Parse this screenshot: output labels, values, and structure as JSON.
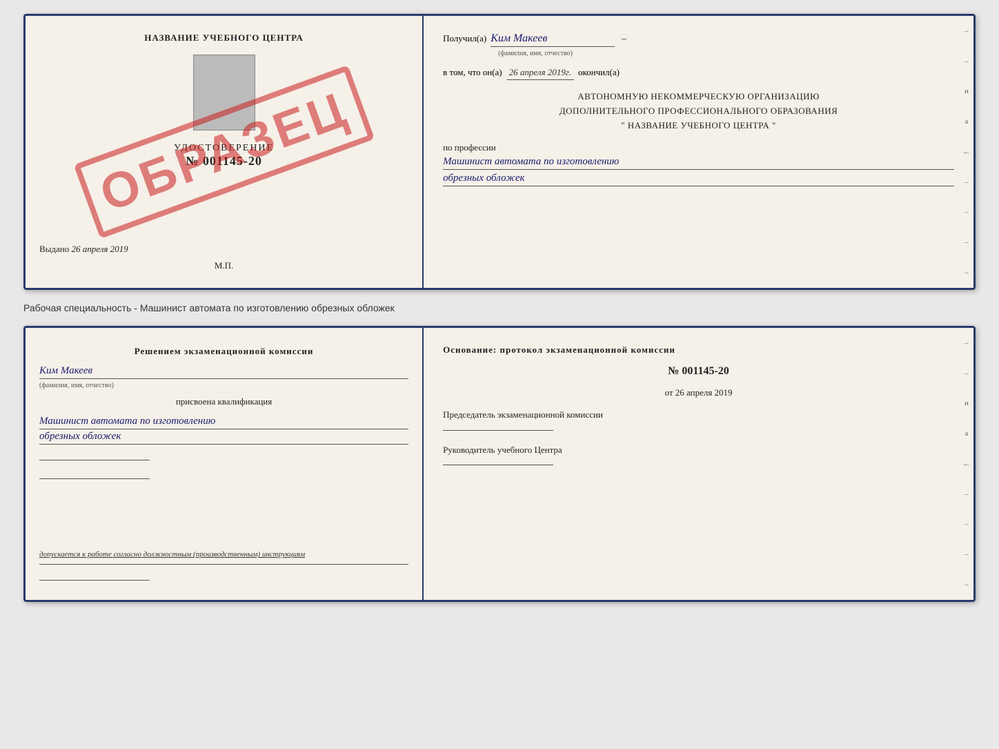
{
  "top_card": {
    "left": {
      "center_title": "НАЗВАНИЕ УЧЕБНОГО ЦЕНТРА",
      "udostoverenie_label": "УДОСТОВЕРЕНИЕ",
      "number": "№ 001145-20",
      "vydano_label": "Выдано",
      "vydano_date": "26 апреля 2019",
      "mp_label": "М.П.",
      "stamp": "ОБРАЗЕЦ"
    },
    "right": {
      "poluchil_prefix": "Получил(а)",
      "poluchil_name": "Ким Макеев",
      "sub_fio": "(фамилия, имя, отчество)",
      "dash": "–",
      "vtom_label": "в том, что он(а)",
      "vtom_date": "26 апреля 2019г.",
      "okoncil_label": "окончил(а)",
      "org_line1": "АВТОНОМНУЮ НЕКОММЕРЧЕСКУЮ ОРГАНИЗАЦИЮ",
      "org_line2": "ДОПОЛНИТЕЛЬНОГО ПРОФЕССИОНАЛЬНОГО ОБРАЗОВАНИЯ",
      "org_line3": "\"  НАЗВАНИЕ УЧЕБНОГО ЦЕНТРА  \"",
      "profesia_label": "по профессии",
      "profesia_line1": "Машинист автомата по изготовлению",
      "profesia_line2": "обрезных обложек"
    }
  },
  "caption": {
    "text": "Рабочая специальность - Машинист автомата по изготовлению обрезных обложек"
  },
  "bottom_card": {
    "left": {
      "resheniem_label": "Решением экзаменационной комиссии",
      "komissia_name": "Ким Макеев",
      "sub_fio": "(фамилия, имя, отчество)",
      "prisvoena_label": "присвоена квалификация",
      "kvali_line1": "Машинист автомата по изготовлению",
      "kvali_line2": "обрезных обложек",
      "dopuskaetsya_text": "допускается к работе согласно должностным (производственным) инструкциям"
    },
    "right": {
      "osnovanie_label": "Основание: протокол экзаменационной комиссии",
      "proto_num": "№  001145-20",
      "ot_label": "от",
      "ot_date": "26 апреля 2019",
      "predsedatel_label": "Председатель экзаменационной комиссии",
      "rukovoditel_label": "Руководитель учебного Центра"
    }
  }
}
